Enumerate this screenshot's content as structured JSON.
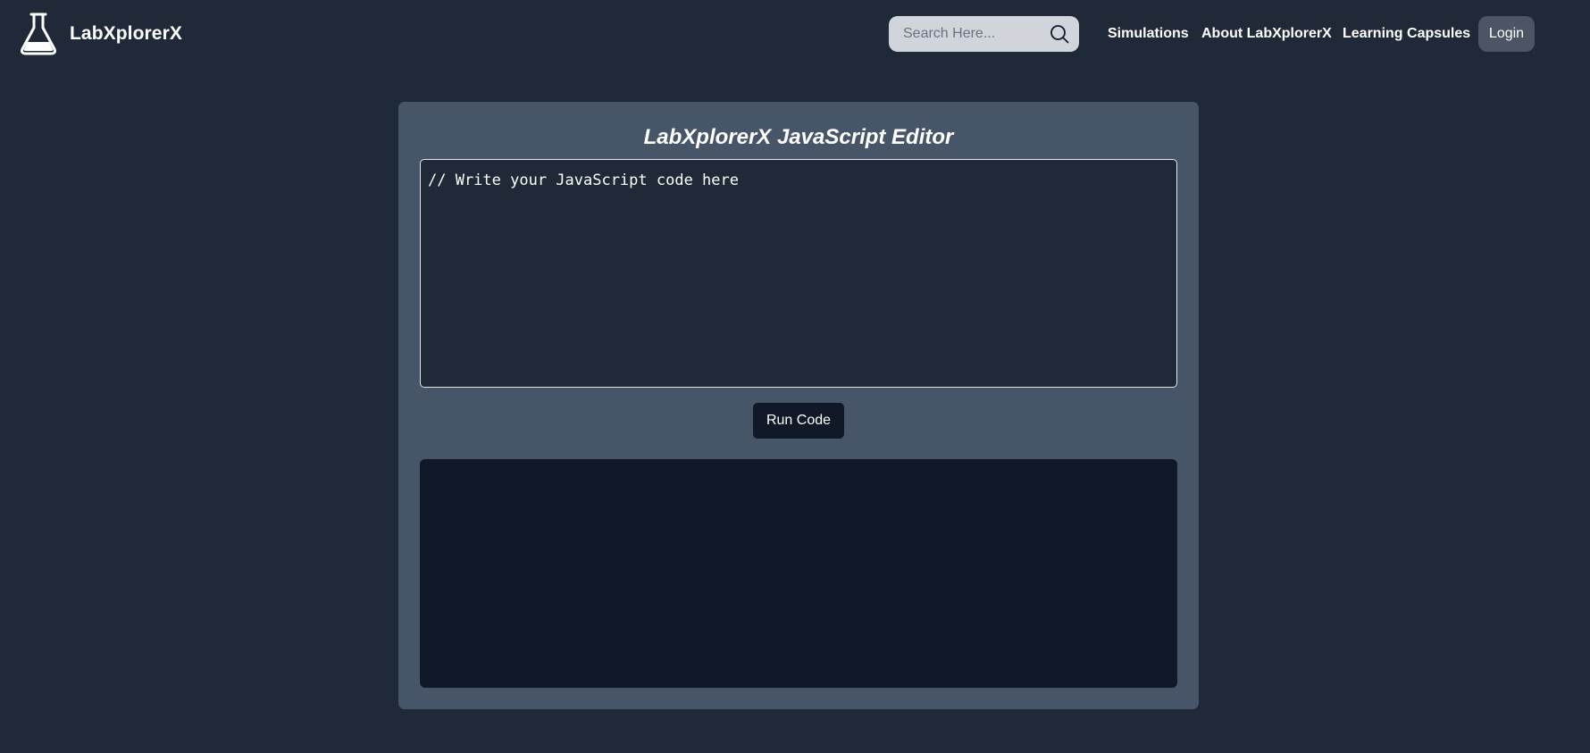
{
  "header": {
    "brand_name": "LabXplorerX",
    "logo_icon": "flask-icon",
    "search": {
      "placeholder": "Search Here...",
      "value": "",
      "icon": "search-icon"
    },
    "nav": [
      {
        "label": "Simulations"
      },
      {
        "label": "About LabXplorerX"
      },
      {
        "label": "Learning Capsules"
      }
    ],
    "login_label": "Login"
  },
  "editor": {
    "title": "LabXplorerX JavaScript Editor",
    "code": "// Write your JavaScript code here",
    "run_label": "Run Code",
    "output": ""
  },
  "colors": {
    "background": "#1f2937",
    "card": "#475569",
    "output_bg": "#111827",
    "search_bg": "#d1d5db",
    "login_bg": "#4b5563"
  }
}
